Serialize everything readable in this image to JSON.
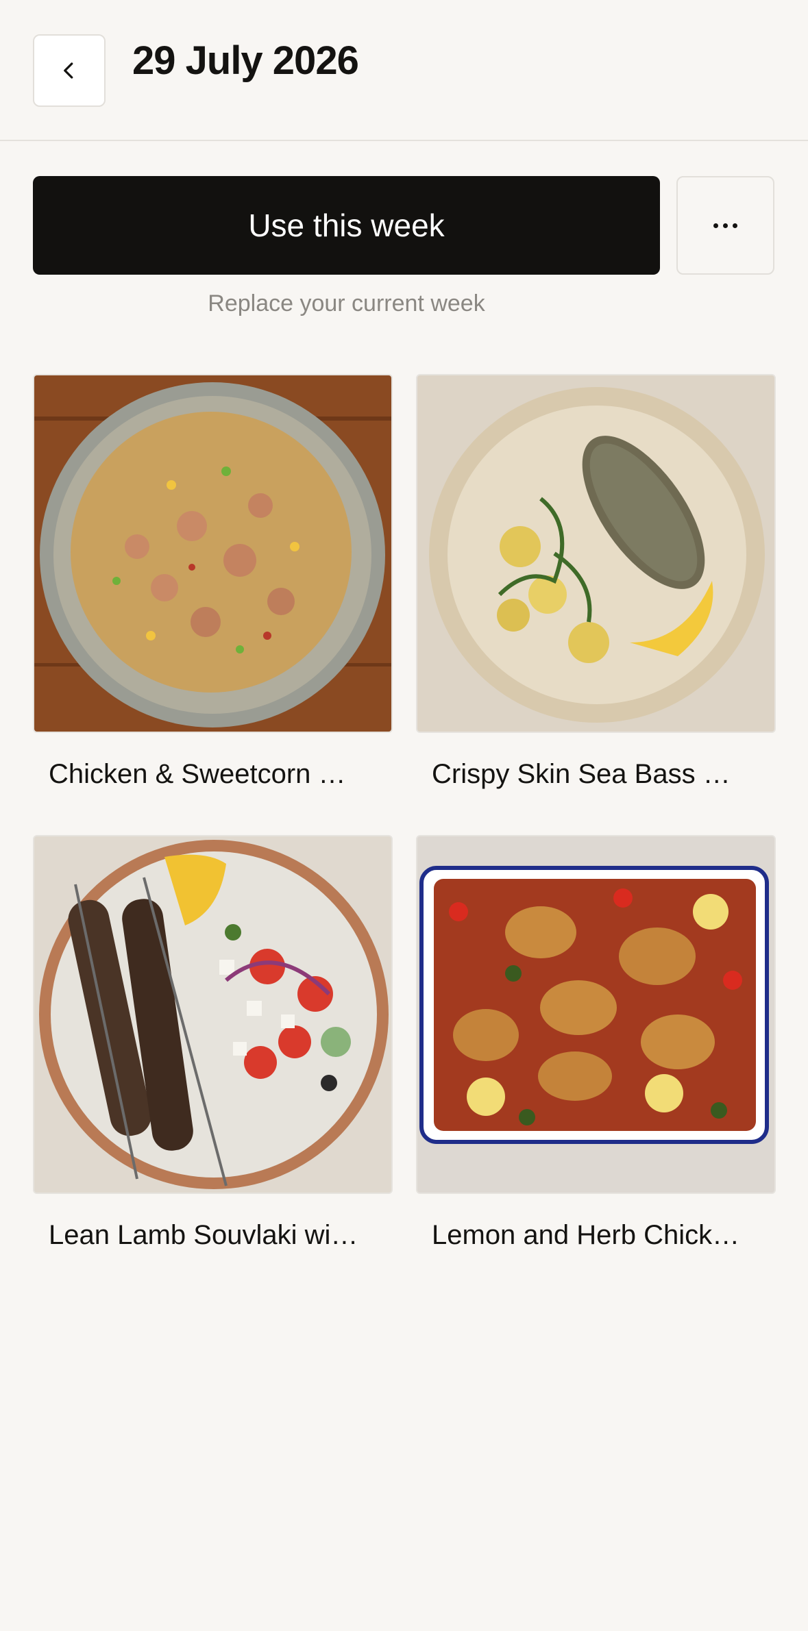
{
  "header": {
    "title": "29 July 2026",
    "back_icon": "chevron-left-icon"
  },
  "actions": {
    "primary_label": "Use this week",
    "more_icon": "more-horizontal-icon",
    "subtext": "Replace your current week"
  },
  "recipes": [
    {
      "name": "Chicken & Sweetcorn …"
    },
    {
      "name": "Crispy Skin Sea Bass …"
    },
    {
      "name": "Lean Lamb Souvlaki wi…"
    },
    {
      "name": "Lemon and Herb Chick…"
    }
  ],
  "colors": {
    "background": "#f8f6f3",
    "primary_button": "#12110f",
    "muted_text": "#8a8782"
  }
}
